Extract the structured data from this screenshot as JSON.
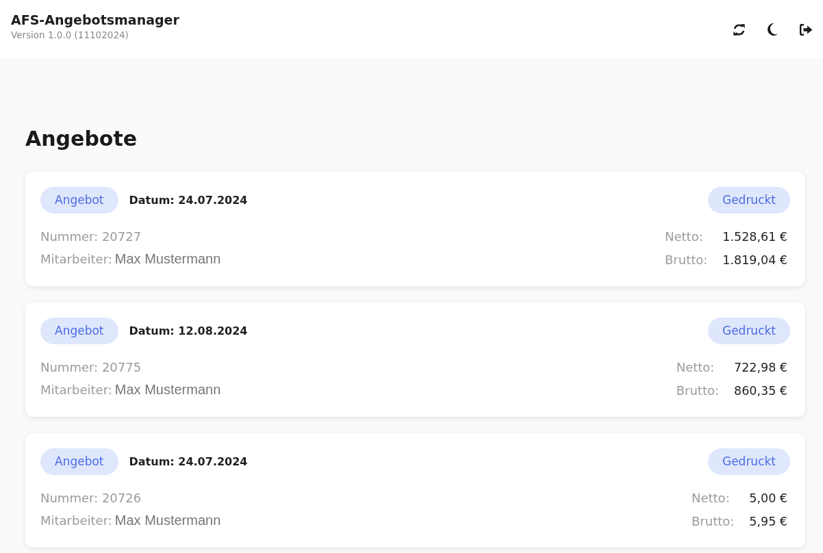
{
  "app": {
    "title": "AFS-Angebotsmanager",
    "version": "Version 1.0.0 (11102024)"
  },
  "page_title": "Angebote",
  "offers": [
    {
      "type_label": "Angebot",
      "date": "Datum: 24.07.2024",
      "status": "Gedruckt",
      "number": "Nummer: 20727",
      "employee_label": "Mitarbeiter:",
      "employee": "Max Mustermann",
      "net_label": "Netto:",
      "net": "1.528,61 €",
      "gross_label": "Brutto:",
      "gross": "1.819,04 €"
    },
    {
      "type_label": "Angebot",
      "date": "Datum: 12.08.2024",
      "status": "Gedruckt",
      "number": "Nummer: 20775",
      "employee_label": "Mitarbeiter:",
      "employee": "Max Mustermann",
      "net_label": "Netto:",
      "net": "722,98 €",
      "gross_label": "Brutto:",
      "gross": "860,35 €"
    },
    {
      "type_label": "Angebot",
      "date": "Datum: 24.07.2024",
      "status": "Gedruckt",
      "number": "Nummer: 20726",
      "employee_label": "Mitarbeiter:",
      "employee": "Max Mustermann",
      "net_label": "Netto:",
      "net": "5,00 €",
      "gross_label": "Brutto:",
      "gross": "5,95 €"
    }
  ]
}
